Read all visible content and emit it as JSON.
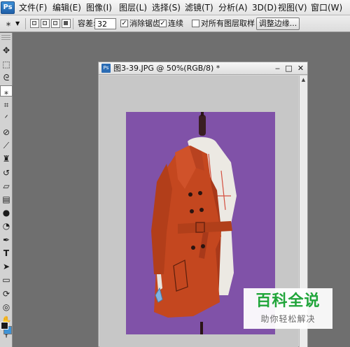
{
  "app": {
    "logo": "Ps"
  },
  "menu": [
    "文件(F)",
    "编辑(E)",
    "图像(I)",
    "图层(L)",
    "选择(S)",
    "滤镜(T)",
    "分析(A)",
    "3D(D)",
    "视图(V)",
    "窗口(W)"
  ],
  "options": {
    "tool_icon": "magic-wand-icon",
    "tolerance_label": "容差:",
    "tolerance_value": "32",
    "anti_alias_label": "消除锯齿",
    "anti_alias_checked": true,
    "contiguous_label": "连续",
    "contiguous_checked": true,
    "sample_all_label": "对所有图层取样",
    "sample_all_checked": false,
    "refine_edge_label": "调整边缘..."
  },
  "tools": [
    "move-icon",
    "marquee-icon",
    "lasso-icon",
    "magic-wand-icon",
    "crop-icon",
    "eyedropper-icon",
    "healing-brush-icon",
    "brush-icon",
    "clone-stamp-icon",
    "history-brush-icon",
    "eraser-icon",
    "gradient-icon",
    "blur-icon",
    "dodge-icon",
    "pen-icon",
    "type-icon",
    "path-selection-icon",
    "shape-icon",
    "3d-rotate-icon",
    "3d-orbit-icon",
    "hand-icon",
    "zoom-icon"
  ],
  "colors": {
    "foreground": "#1a1a1a",
    "background": "#3e93d6",
    "canvas_bg": "#8052a8",
    "coat": "#c4471f"
  },
  "document": {
    "icon": "Ps",
    "title": "图3-39.JPG @ 50%(RGB/8) *",
    "minimize": "‒",
    "maximize": "□",
    "close": "✕"
  },
  "watermark": {
    "title": "百科全说",
    "subtitle": "助你轻松解决"
  }
}
